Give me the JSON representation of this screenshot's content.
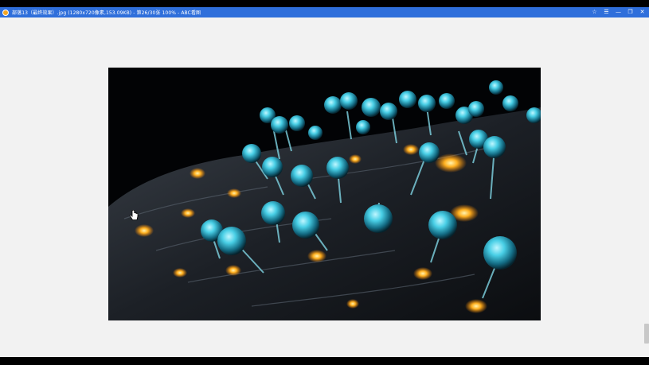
{
  "titlebar": {
    "title": "部落13（最终效果）.jpg (1280x720像素,153.09KB) - 第26/30张 100% - ABC看图"
  },
  "window_buttons": {
    "pin": "☆",
    "menu": "☰",
    "minimize": "—",
    "restore": "❐",
    "close": "✕"
  },
  "icons": [
    "app-icon",
    "pin-icon",
    "menu-icon",
    "minimize-icon",
    "restore-icon",
    "close-icon",
    "hand-cursor-icon"
  ],
  "colors": {
    "titlebar": "#2f6fdb",
    "viewer_bg": "#f2f2f2",
    "glow_orange": "#ffb020",
    "bulb_cyan": "#3fc8e0"
  }
}
